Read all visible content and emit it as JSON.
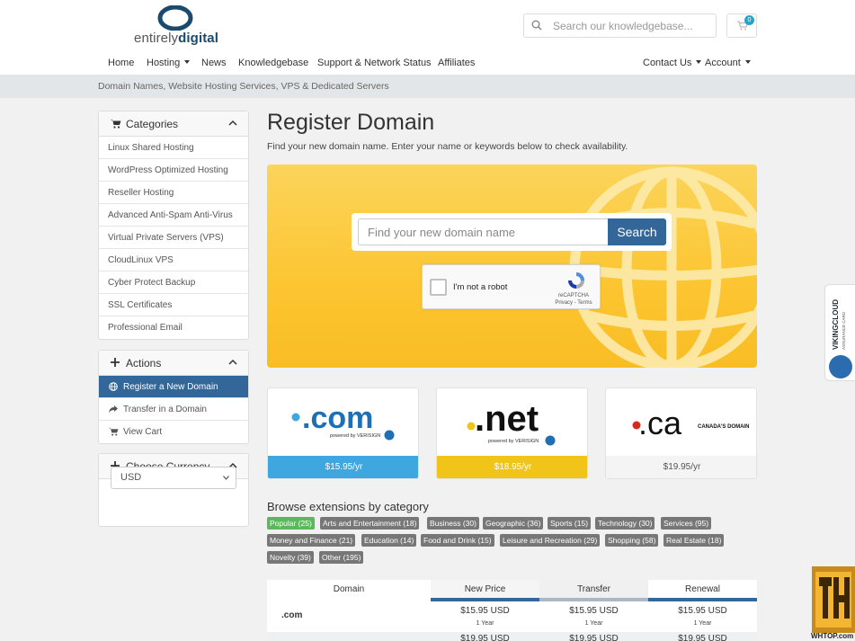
{
  "brand": {
    "logo_text_light": "entirely",
    "logo_text_bold": "digital"
  },
  "header_search": {
    "placeholder": "Search our knowledgebase..."
  },
  "cart": {
    "count": "0"
  },
  "nav": {
    "home": "Home",
    "hosting": "Hosting",
    "news": "News",
    "knowledgebase": "Knowledgebase",
    "status": "Support & Network Status",
    "affiliates": "Affiliates",
    "contact": "Contact Us",
    "account": "Account"
  },
  "breadcrumb": "Domain Names, Website Hosting Services, VPS & Dedicated Servers",
  "sidebar": {
    "categories": {
      "title": "Categories",
      "items": [
        "Linux Shared Hosting",
        "WordPress Optimized Hosting",
        "Reseller Hosting",
        "Advanced Anti-Spam Anti-Virus",
        "Virtual Private Servers (VPS)",
        "CloudLinux VPS",
        "Cyber Protect Backup",
        "SSL Certificates",
        "Professional Email"
      ]
    },
    "actions": {
      "title": "Actions",
      "items": [
        "Register a New Domain",
        "Transfer in a Domain",
        "View Cart"
      ]
    },
    "currency": {
      "title": "Choose Currency",
      "selected": "USD"
    }
  },
  "main": {
    "title": "Register Domain",
    "subtitle": "Find your new domain name. Enter your name or keywords below to check availability.",
    "domain_placeholder": "Find your new domain name",
    "search_label": "Search",
    "recaptcha": {
      "label": "I'm not a robot",
      "brand": "reCAPTCHA",
      "links": "Privacy - Terms"
    }
  },
  "tld_cards": [
    {
      "name": ".com",
      "powered": "powered by VERISIGN",
      "price": "$15.95/yr",
      "color": "#3fa7df"
    },
    {
      "name": ".net",
      "powered": "powered by VERISIGN",
      "price": "$18.95/yr",
      "color": "#f0c419"
    },
    {
      "name": ".ca",
      "powered": "CANADA'S DOMAIN",
      "price": "$19.95/yr",
      "color": "#f4f4f4"
    }
  ],
  "browse": {
    "title": "Browse extensions by category",
    "tags": [
      "Popular (25)",
      "Arts and Entertainment (18)",
      "Business (30)",
      "Geographic (36)",
      "Sports (15)",
      "Technology (30)",
      "Services (95)",
      "Money and Finance (21)",
      "Education (14)",
      "Food and Drink (15)",
      "Leisure and Recreation (29)",
      "Shopping (58)",
      "Real Estate (18)",
      "Novelty (39)",
      "Other (195)"
    ]
  },
  "pricing": {
    "headers": [
      "Domain",
      "New Price",
      "Transfer",
      "Renewal"
    ],
    "rows": [
      {
        "tld": ".com",
        "new": "$15.95 USD",
        "new_term": "1 Year",
        "transfer": "$15.95 USD",
        "transfer_term": "1 Year",
        "renewal": "$15.95 USD",
        "renewal_term": "1 Year"
      },
      {
        "new": "$19.95 USD",
        "transfer": "$19.95 USD",
        "renewal": "$19.95 USD"
      }
    ]
  },
  "widgets": {
    "viking_title": "VIKINGCLOUD",
    "viking_sub": "ASSURANCE CARD",
    "whtop_url": "WHTOP.com"
  },
  "colors": {
    "primary": "#336699",
    "hero_yellow": "#fcc531",
    "tag_green": "#5cb85c",
    "tag_gray": "#777777"
  }
}
